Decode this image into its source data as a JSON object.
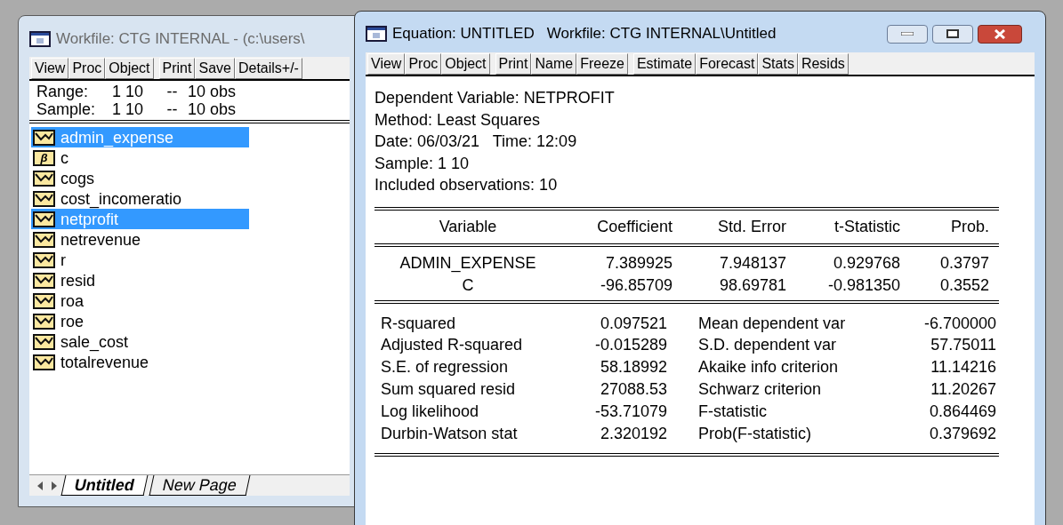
{
  "workfile_window": {
    "title": "Workfile: CTG INTERNAL - (c:\\users\\",
    "toolbar": [
      [
        "View",
        "Proc",
        "Object"
      ],
      [
        "Print",
        "Save",
        "Details+/-"
      ]
    ],
    "range_lines": [
      {
        "label": "Range:",
        "span": "1 10",
        "sep": "--",
        "count": "10 obs"
      },
      {
        "label": "Sample:",
        "span": "1 10",
        "sep": "--",
        "count": "10 obs"
      }
    ],
    "objects": [
      {
        "name": "admin_expense",
        "kind": "series",
        "selected": true
      },
      {
        "name": "c",
        "kind": "coef",
        "badge": "β",
        "selected": false
      },
      {
        "name": "cogs",
        "kind": "series",
        "selected": false
      },
      {
        "name": "cost_incomeratio",
        "kind": "series",
        "selected": false
      },
      {
        "name": "netprofit",
        "kind": "series",
        "selected": true
      },
      {
        "name": "netrevenue",
        "kind": "series",
        "selected": false
      },
      {
        "name": "r",
        "kind": "series",
        "selected": false
      },
      {
        "name": "resid",
        "kind": "series",
        "selected": false
      },
      {
        "name": "roa",
        "kind": "series",
        "selected": false
      },
      {
        "name": "roe",
        "kind": "series",
        "selected": false
      },
      {
        "name": "sale_cost",
        "kind": "series",
        "selected": false
      },
      {
        "name": "totalrevenue",
        "kind": "series",
        "selected": false
      }
    ],
    "page_tabs": [
      {
        "label": "Untitled",
        "selected": true
      },
      {
        "label": "New Page",
        "selected": false
      }
    ]
  },
  "equation_window": {
    "title": "Equation: UNTITLED   Workfile: CTG INTERNAL\\Untitled",
    "toolbar": [
      [
        "View",
        "Proc",
        "Object"
      ],
      [
        "Print",
        "Name",
        "Freeze"
      ],
      [
        "Estimate",
        "Forecast",
        "Stats",
        "Resids"
      ]
    ],
    "header_lines": [
      "Dependent Variable: NETPROFIT",
      "Method: Least Squares",
      "Date: 06/03/21   Time: 12:09",
      "Sample: 1 10",
      "Included observations: 10"
    ],
    "coefficients": {
      "columns": [
        "Variable",
        "Coefficient",
        "Std. Error",
        "t-Statistic",
        "Prob."
      ],
      "rows": [
        [
          "ADMIN_EXPENSE",
          "7.389925",
          "7.948137",
          "0.929768",
          "0.3797"
        ],
        [
          "C",
          "-96.85709",
          "98.69781",
          "-0.981350",
          "0.3552"
        ]
      ]
    },
    "statistics": [
      [
        "R-squared",
        "0.097521",
        "Mean dependent var",
        "-6.700000"
      ],
      [
        "Adjusted R-squared",
        "-0.015289",
        "S.D. dependent var",
        "57.75011"
      ],
      [
        "S.E. of regression",
        "58.18992",
        "Akaike info criterion",
        "11.14216"
      ],
      [
        "Sum squared resid",
        "27088.53",
        "Schwarz criterion",
        "11.20267"
      ],
      [
        "Log likelihood",
        "-53.71079",
        "F-statistic",
        "0.864469"
      ],
      [
        "Durbin-Watson stat",
        "2.320192",
        "Prob(F-statistic)",
        "0.379692"
      ]
    ]
  }
}
